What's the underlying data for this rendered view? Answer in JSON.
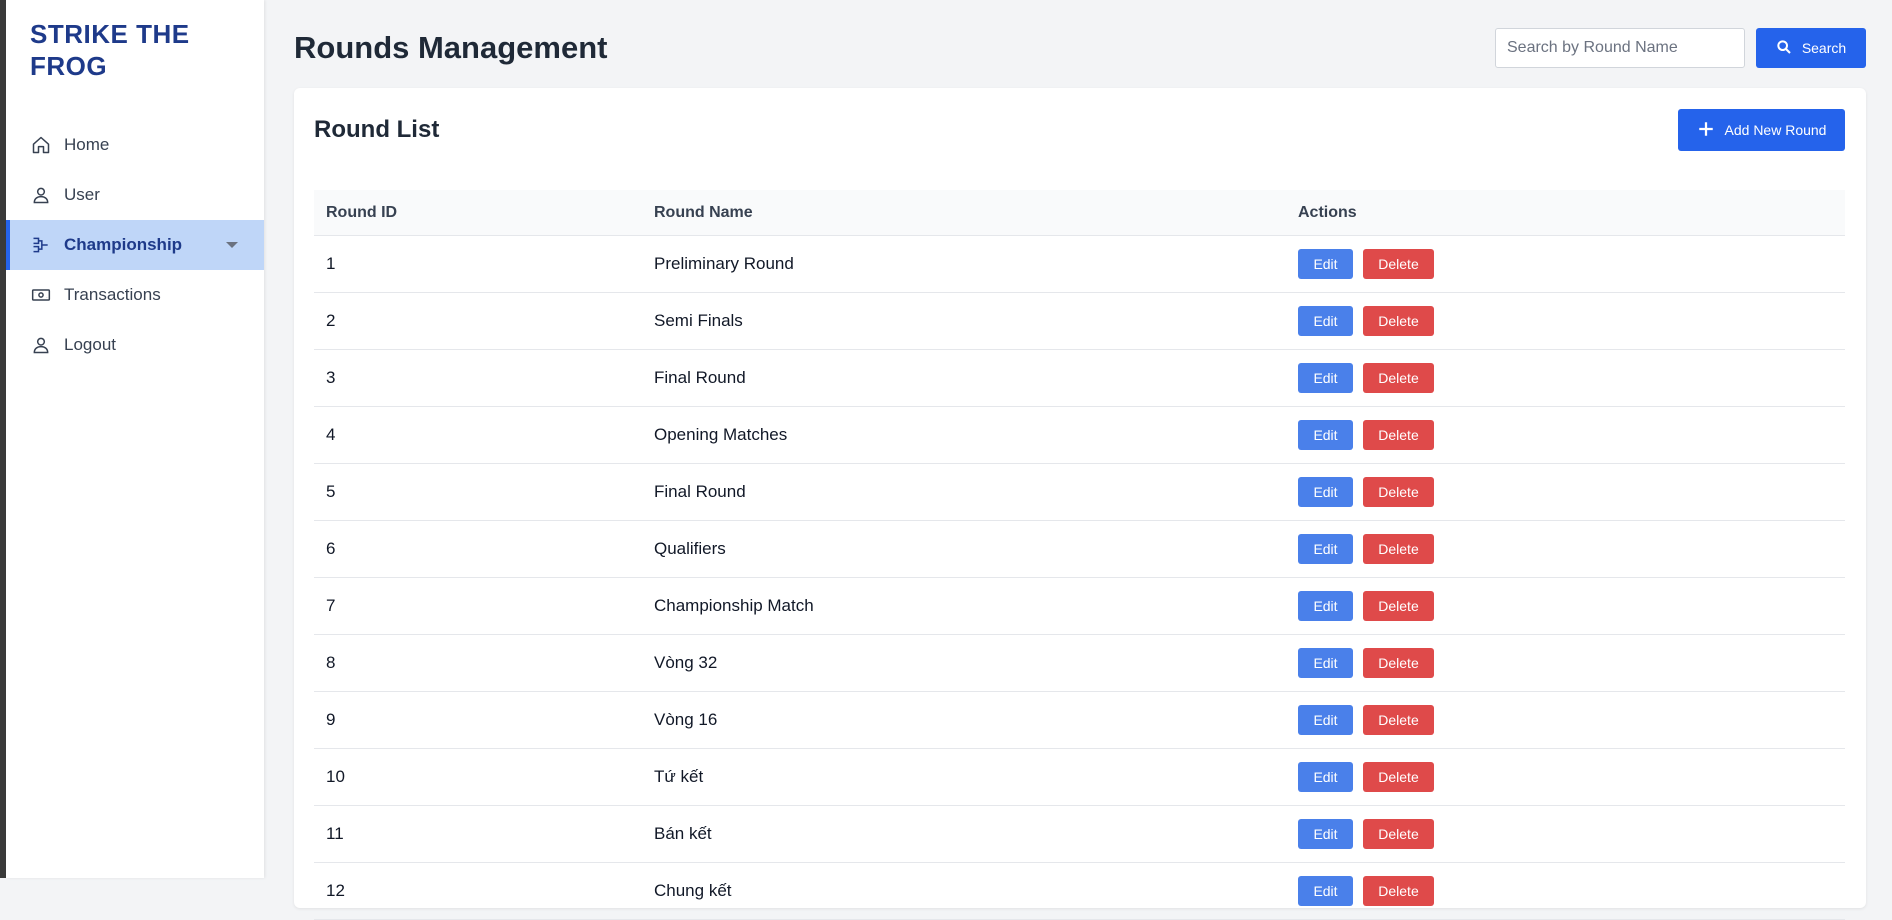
{
  "brand": "STRIKE THE FROG",
  "sidebar": {
    "items": [
      {
        "label": "Home",
        "icon": "home-icon"
      },
      {
        "label": "User",
        "icon": "user-icon"
      },
      {
        "label": "Championship",
        "icon": "bracket-icon",
        "active": true
      },
      {
        "label": "Transactions",
        "icon": "banknote-icon"
      },
      {
        "label": "Logout",
        "icon": "logout-icon"
      }
    ]
  },
  "header": {
    "title": "Rounds Management",
    "search_placeholder": "Search by Round Name",
    "search_label": "Search"
  },
  "card": {
    "title": "Round List",
    "add_label": "Add New Round"
  },
  "table": {
    "columns": [
      "Round ID",
      "Round Name",
      "Actions"
    ],
    "edit_label": "Edit",
    "delete_label": "Delete",
    "rows": [
      {
        "id": "1",
        "name": "Preliminary Round"
      },
      {
        "id": "2",
        "name": "Semi Finals"
      },
      {
        "id": "3",
        "name": "Final Round"
      },
      {
        "id": "4",
        "name": "Opening Matches"
      },
      {
        "id": "5",
        "name": "Final Round"
      },
      {
        "id": "6",
        "name": "Qualifiers"
      },
      {
        "id": "7",
        "name": "Championship Match"
      },
      {
        "id": "8",
        "name": "Vòng 32"
      },
      {
        "id": "9",
        "name": "Vòng 16"
      },
      {
        "id": "10",
        "name": "Tứ kết"
      },
      {
        "id": "11",
        "name": "Bán kết"
      },
      {
        "id": "12",
        "name": "Chung kết"
      }
    ]
  },
  "colors": {
    "accent": "#2563eb",
    "brand": "#1e3a8a",
    "active_bg": "#bfd6f8",
    "edit": "#4a80ea",
    "delete": "#df4a4a"
  }
}
